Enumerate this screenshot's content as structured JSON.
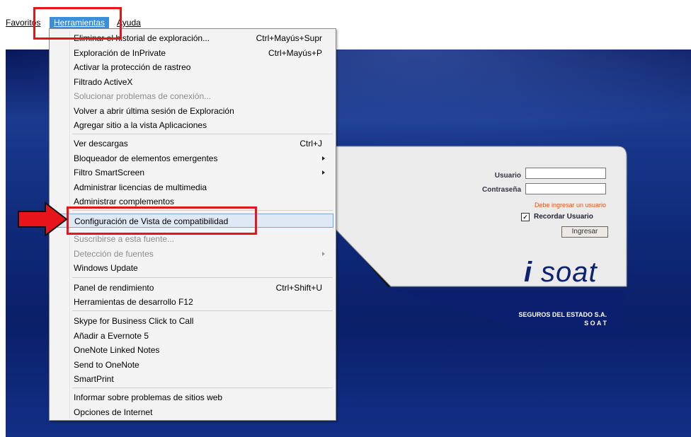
{
  "menubar": {
    "favoritos": "Favoritos",
    "herramientas": "Herramientas",
    "ayuda": "Ayuda"
  },
  "dropdown": {
    "items": [
      {
        "label": "Eliminar el historial de exploración...",
        "shortcut": "Ctrl+Mayús+Supr"
      },
      {
        "label": "Exploración de InPrivate",
        "shortcut": "Ctrl+Mayús+P"
      },
      {
        "label": "Activar la protección de rastreo",
        "shortcut": ""
      },
      {
        "label": "Filtrado ActiveX",
        "shortcut": ""
      },
      {
        "label": "Solucionar problemas de conexión...",
        "shortcut": "",
        "disabled": true
      },
      {
        "label": "Volver a abrir última sesión de Exploración",
        "shortcut": ""
      },
      {
        "label": "Agregar sitio a la vista Aplicaciones",
        "shortcut": ""
      },
      {
        "label": "Ver descargas",
        "shortcut": "Ctrl+J"
      },
      {
        "label": "Bloqueador de elementos emergentes",
        "shortcut": "",
        "submenu": true
      },
      {
        "label": "Filtro SmartScreen",
        "shortcut": "",
        "submenu": true
      },
      {
        "label": "Administrar licencias de multimedia",
        "shortcut": ""
      },
      {
        "label": "Administrar complementos",
        "shortcut": ""
      },
      {
        "label": "Configuración de Vista de compatibilidad",
        "shortcut": "",
        "highlighted": true
      },
      {
        "label": "Suscribirse a esta fuente...",
        "shortcut": "",
        "disabled": true
      },
      {
        "label": "Detección de fuentes",
        "shortcut": "",
        "submenu": true,
        "disabled": true
      },
      {
        "label": "Windows Update",
        "shortcut": ""
      },
      {
        "label": "Panel de rendimiento",
        "shortcut": "Ctrl+Shift+U"
      },
      {
        "label": "Herramientas de desarrollo F12",
        "shortcut": ""
      },
      {
        "label": "Skype for Business Click to Call",
        "shortcut": ""
      },
      {
        "label": "Añadir a Evernote 5",
        "shortcut": ""
      },
      {
        "label": "OneNote Linked Notes",
        "shortcut": ""
      },
      {
        "label": "Send to OneNote",
        "shortcut": ""
      },
      {
        "label": "SmartPrint",
        "shortcut": ""
      },
      {
        "label": "Informar sobre problemas de sitios web",
        "shortcut": ""
      },
      {
        "label": "Opciones de Internet",
        "shortcut": ""
      }
    ]
  },
  "login": {
    "usuario_label": "Usuario",
    "contrasena_label": "Contraseña",
    "warning": "Debe ingresar un usuario",
    "remember_label": "Recordar Usuario",
    "remember_checked": true,
    "ingresar_button": "Ingresar",
    "logo_text": "isoat",
    "company_line1": "SEGUROS DEL ESTADO S.A.",
    "company_line2": "S O A T"
  },
  "colors": {
    "menu_highlight": "#3a8fd8",
    "annotation_red": "#e8141b",
    "page_blue": "#0f2a7a"
  }
}
